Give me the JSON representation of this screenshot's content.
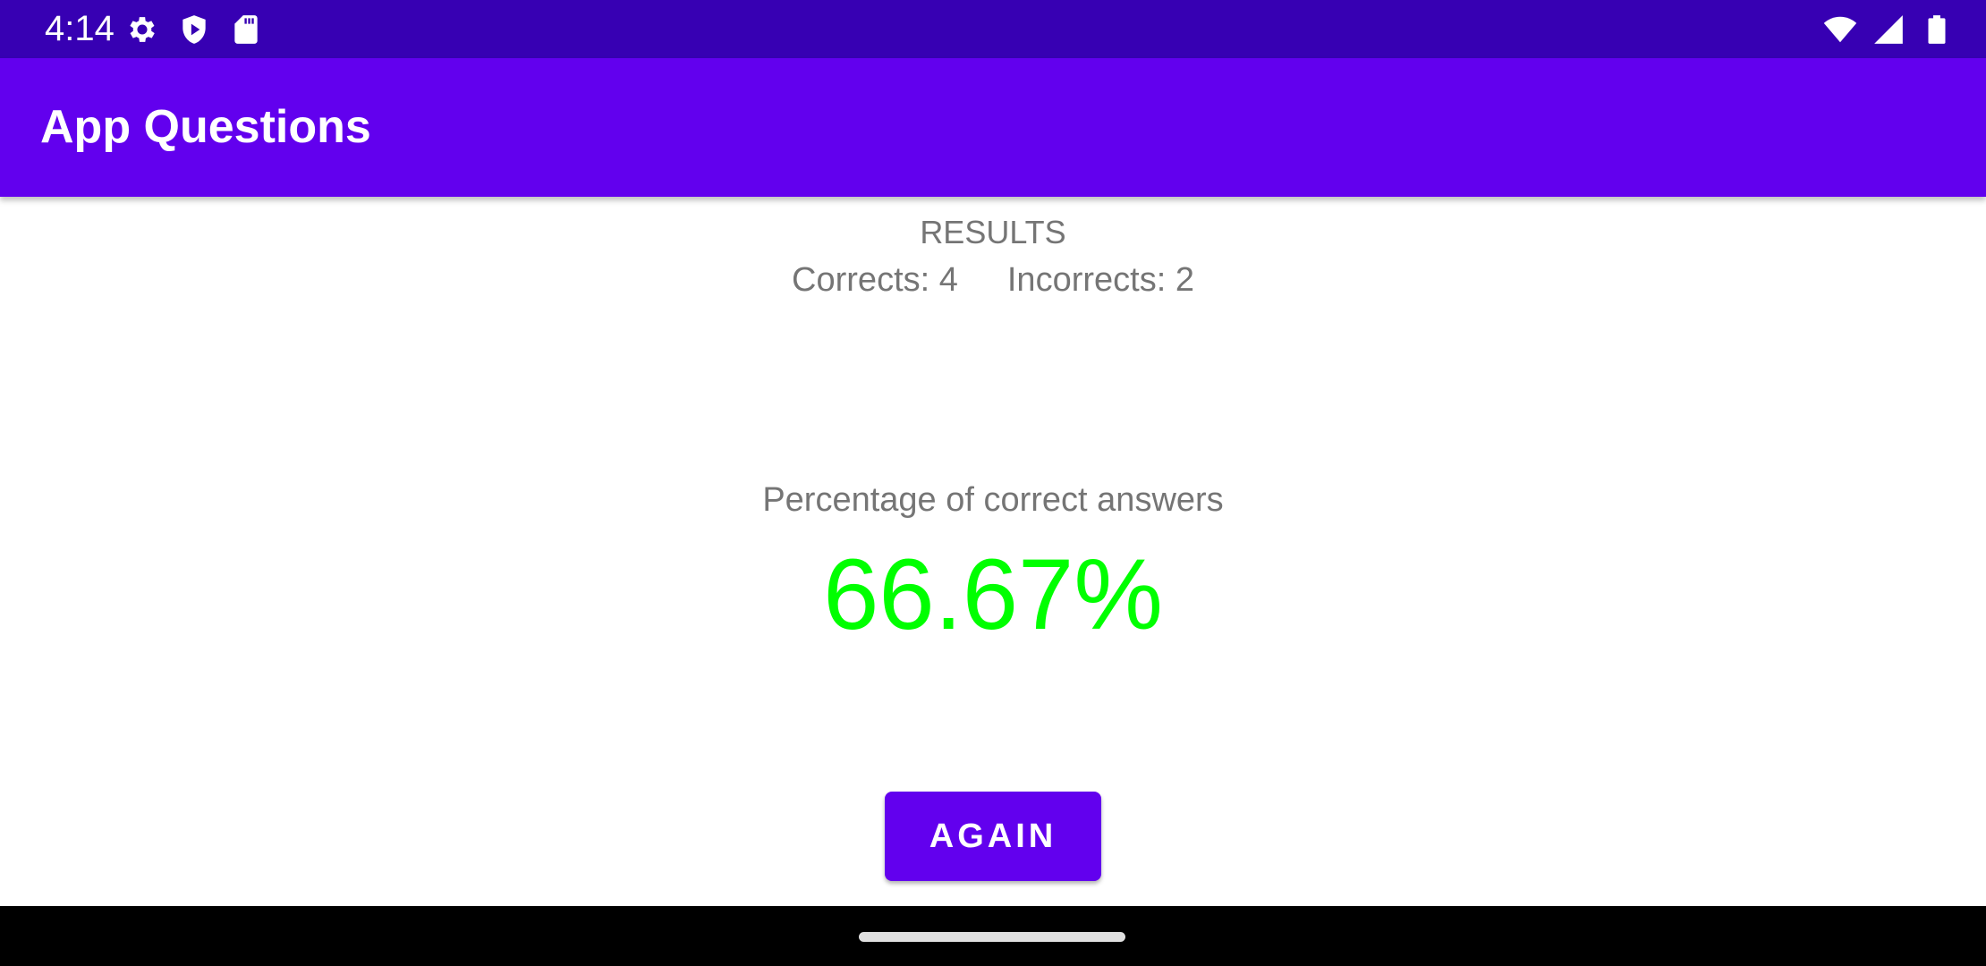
{
  "status_bar": {
    "time": "4:14",
    "left_icons": [
      "gear-icon",
      "shield-play-icon",
      "sd-card-icon"
    ],
    "right_icons": [
      "wifi-icon",
      "cell-signal-icon",
      "battery-icon"
    ],
    "color": "#3700b3"
  },
  "app_bar": {
    "title": "App Questions",
    "color": "#6200ee"
  },
  "results": {
    "title": "RESULTS",
    "corrects": "Corrects: 4",
    "incorrects": "Incorrects: 2"
  },
  "percentage": {
    "label": "Percentage of correct answers",
    "value": "66.67%",
    "color": "#00ff00"
  },
  "actions": {
    "again_label": "AGAIN"
  }
}
